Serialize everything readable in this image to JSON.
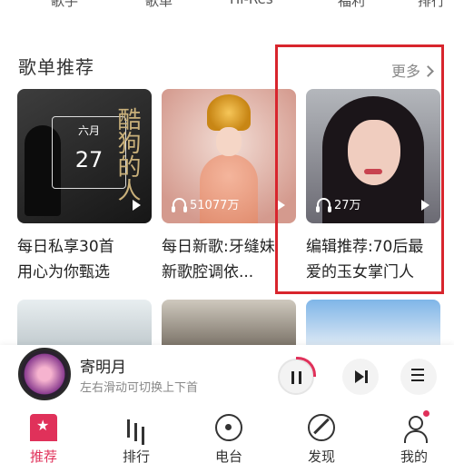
{
  "top_categories": [
    "歌手",
    "歌单",
    "Hi-Res",
    "福利",
    "排行"
  ],
  "section": {
    "title": "歌单推荐",
    "more_label": "更多"
  },
  "playlists": [
    {
      "title_line1": "每日私享30首",
      "title_line2": "用心为你甄选",
      "play_count": "",
      "cover": {
        "month": "六月",
        "day": "27",
        "calligraphy": "酷狗的人"
      }
    },
    {
      "title_line1": "每日新歌:牙缝妹",
      "title_line2": "新歌腔调依...",
      "play_count": "51077万"
    },
    {
      "title_line1": "编辑推荐:70后最",
      "title_line2": "爱的玉女掌门人",
      "play_count": "27万"
    }
  ],
  "player": {
    "song": "寄明月",
    "hint": "左右滑动可切换上下首"
  },
  "tabs": [
    {
      "label": "推荐",
      "icon": "recommend-icon",
      "active": true
    },
    {
      "label": "排行",
      "icon": "rank-icon"
    },
    {
      "label": "电台",
      "icon": "radio-icon"
    },
    {
      "label": "发现",
      "icon": "discover-icon"
    },
    {
      "label": "我的",
      "icon": "me-icon"
    }
  ],
  "colors": {
    "accent": "#e0315a",
    "highlight_box": "#d8252d"
  }
}
